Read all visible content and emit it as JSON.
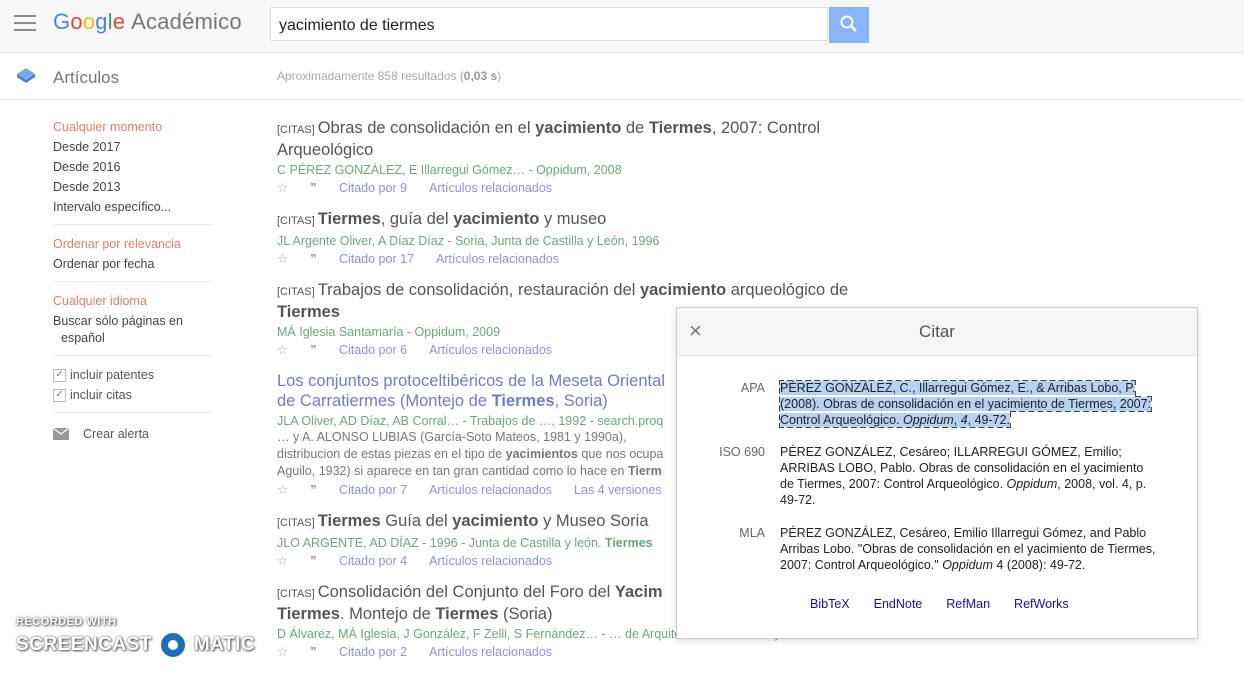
{
  "header": {
    "logo_letters": [
      "G",
      "o",
      "o",
      "g",
      "l",
      "e"
    ],
    "product": "Académico",
    "search_value": "yacimiento de tiermes"
  },
  "subheader": {
    "section": "Artículos",
    "results_prefix": "Aproximadamente 858 resultados (",
    "results_time": "0,03 s",
    "results_suffix": ")"
  },
  "sidebar": {
    "time": [
      "Cualquier momento",
      "Desde 2017",
      "Desde 2016",
      "Desde 2013",
      "Intervalo específico..."
    ],
    "sort": [
      "Ordenar por relevancia",
      "Ordenar por fecha"
    ],
    "lang": [
      "Cualquier idioma",
      "Buscar sólo páginas en",
      "español"
    ],
    "checks": [
      "incluir patentes",
      "incluir citas"
    ],
    "alert": "Crear alerta"
  },
  "results": [
    {
      "tag": "[CITAS]",
      "title": [
        "Obras de consolidación en el ",
        "yacimiento",
        " de ",
        "Tiermes",
        ", 2007: Control Arqueológico"
      ],
      "authors": "C PÉREZ GONZÁLEZ, E Illarregui Gómez… - Oppidum, 2008",
      "cited": "Citado por 9",
      "related": "Artículos relacionados"
    },
    {
      "tag": "[CITAS]",
      "title": [
        "Tiermes",
        ", guía del ",
        "yacimiento",
        " y museo"
      ],
      "authors": "JL Argente Oliver, A Díaz Díaz - Soria, Junta de Castilla y León, 1996",
      "cited": "Citado por 17",
      "related": "Artículos relacionados"
    },
    {
      "tag": "[CITAS]",
      "title": [
        "Trabajos de consolidación, restauración del ",
        "yacimiento",
        " arqueológico de ",
        "Tiermes"
      ],
      "authors": "MÁ Iglesia Santamaría - Oppidum, 2009",
      "cited": "Citado por 6",
      "related": "Artículos relacionados"
    },
    {
      "title": [
        "Los conjuntos protoceltibéricos de la Meseta Oriental",
        "",
        " de Carratiermes (Montejo de ",
        "Tiermes",
        ", Soria)"
      ],
      "authors": "JLA Oliver, AD Díaz, AB Corral… - Trabajos de …, 1992 - search.proq",
      "snippet": [
        "… y A. ALONSO LUBIAS (García-Soto Mateos, 1981 y 1990a), ",
        "distribucion de estas piezas en el tipo de ",
        "yacimientos",
        " que nos ocupa",
        "Aguilo, 1932) si aparece en tan gran cantidad como lo hace en ",
        "Tierm"
      ],
      "cited": "Citado por 7",
      "related": "Artículos relacionados",
      "versions": "Las 4 versiones"
    },
    {
      "tag": "[CITAS]",
      "title": [
        "Tiermes",
        " Guía del ",
        "yacimiento",
        " y Museo Soria"
      ],
      "authors": [
        "JLO ARGENTE, AD DÍAZ - 1996 - Junta de Castilla y león. ",
        "Tiermes"
      ],
      "cited": "Citado por 4",
      "related": "Artículos relacionados"
    },
    {
      "tag": "[CITAS]",
      "title": [
        "Consolidación del Conjunto del Foro del ",
        "Yacim",
        "Tiermes",
        ". Montejo de ",
        "Tiermes",
        " (Soria)"
      ],
      "authors": "D Álvarez, MÁ Iglesia, J González, F Zelli, S Fernández… - … de Arquitectura de Castilla y León …",
      "cited": "Citado por 2",
      "related": "Artículos relacionados"
    }
  ],
  "modal": {
    "title": "Citar",
    "close": "×",
    "apa_label": "APA",
    "apa": [
      "PÉREZ GONZÁLEZ, C., Illarregui Gómez, E., & Arribas Lobo, P. (2008). Obras de consolidación en el yacimiento de Tiermes, 2007: Control Arqueológico. ",
      "Oppidum",
      ", ",
      "4",
      ", 49-72."
    ],
    "iso_label": "ISO 690",
    "iso": [
      "PÉREZ GONZÁLEZ, Cesáreo; ILLARREGUI GÓMEZ, Emilio; ARRIBAS LOBO, Pablo. Obras de consolidación en el yacimiento de Tiermes, 2007: Control Arqueológico. ",
      "Oppidum",
      ", 2008, vol. 4, p. 49-72."
    ],
    "mla_label": "MLA",
    "mla": [
      "PÉREZ GONZÁLEZ, Cesáreo, Emilio Illarregui Gómez, and Pablo Arribas Lobo. \"Obras de consolidación en el yacimiento de Tiermes, 2007: Control Arqueológico.\" ",
      "Oppidum",
      " 4 (2008): 49-72."
    ],
    "formats": [
      "BibTeX",
      "EndNote",
      "RefMan",
      "RefWorks"
    ]
  },
  "watermark": {
    "line1": "RECORDED WITH",
    "left": "SCREENCAST",
    "right": "MATIC"
  }
}
